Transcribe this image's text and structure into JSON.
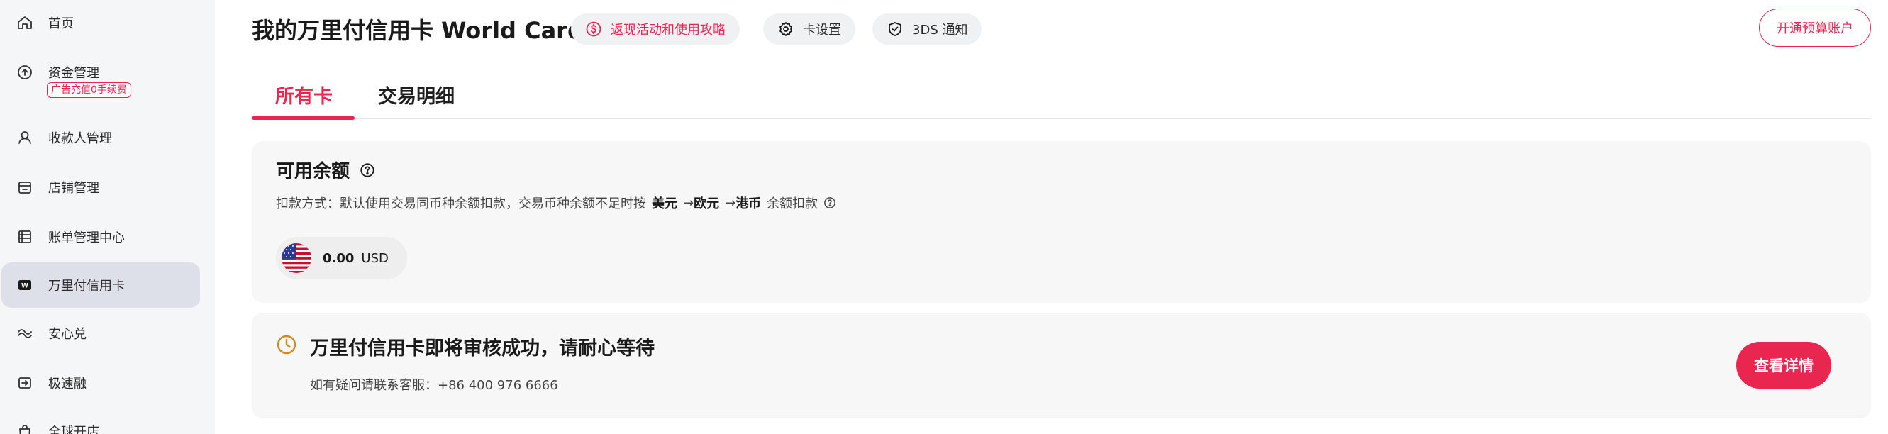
{
  "sidebar": {
    "items": [
      {
        "label": "首页",
        "icon": "home-icon"
      },
      {
        "label": "资金管理",
        "icon": "arrow-up-circle-icon",
        "badge": "广告充值0手续费"
      },
      {
        "label": "收款人管理",
        "icon": "user-icon"
      },
      {
        "label": "店铺管理",
        "icon": "store-icon"
      },
      {
        "label": "账单管理中心",
        "icon": "bill-icon"
      },
      {
        "label": "万里付信用卡",
        "icon": "card-w-icon",
        "active": true
      },
      {
        "label": "安心兑",
        "icon": "exchange-icon"
      },
      {
        "label": "极速融",
        "icon": "finance-icon"
      },
      {
        "label": "全球开店",
        "icon": "shop-bag-icon"
      }
    ]
  },
  "header": {
    "title": "我的万里付信用卡 World Card",
    "cashback_label": "返现活动和使用攻略",
    "card_settings_label": "卡设置",
    "tds_label": "3DS 通知",
    "open_budget_label": "开通预算账户"
  },
  "tabs": [
    {
      "label": "所有卡",
      "active": true
    },
    {
      "label": "交易明细",
      "active": false
    }
  ],
  "balance": {
    "title": "可用余额",
    "deduct_prefix": "扣款方式：默认使用交易同币种余额扣款，交易币种余额不足时按",
    "currency_1": "美元",
    "arrow_1": "→",
    "currency_2": "欧元",
    "arrow_2": "→",
    "currency_3": "港币",
    "deduct_suffix": "余额扣款",
    "amount": "0.00",
    "currency": "USD",
    "flag": "us-flag-icon"
  },
  "status": {
    "title": "万里付信用卡即将审核成功，请耐心等待",
    "contact": "如有疑问请联系客服：+86 400 976 6666",
    "button_label": "查看详情"
  },
  "colors": {
    "accent": "#e8264f",
    "sidebar_bg": "#f5f6f7",
    "sidebar_active": "#dde0e8",
    "panel_bg": "#f7f7f8",
    "clock": "#d4891f"
  }
}
